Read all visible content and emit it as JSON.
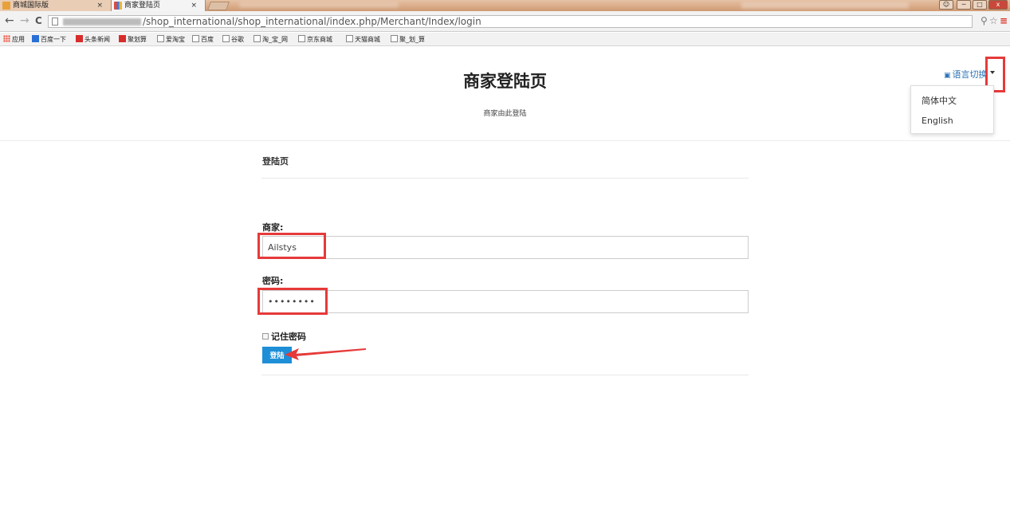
{
  "browser": {
    "tabs": [
      {
        "label": "商城国际版",
        "active": false,
        "close": "×"
      },
      {
        "label": "商家登陆页",
        "active": true,
        "close": "×"
      }
    ],
    "window_controls": {
      "minimize": "─",
      "maximize": "□",
      "close": "x"
    },
    "nav": {
      "back": "←",
      "forward": "→",
      "reload": "C"
    },
    "url_path": "/shop_international/shop_international/index.php/Merchant/Index/login",
    "bookmarks": [
      "应用",
      "百度一下",
      "头条新闻",
      "聚划算",
      "爱淘宝",
      "百度",
      "谷歌",
      "淘_宝_网",
      "京东商城",
      "天猫商城",
      "聚_划_算"
    ]
  },
  "header": {
    "title": "商家登陆页",
    "subtitle": "商家由此登陆",
    "lang_toggle": "语言切换",
    "lang_options": [
      "简体中文",
      "English"
    ]
  },
  "form": {
    "panel_title": "登陆页",
    "merchant_label": "商家:",
    "merchant_value": "Ailstys",
    "password_label": "密码:",
    "password_value": "••••••••",
    "remember_label": "记住密码",
    "remember_checked": false,
    "submit_label": "登陆"
  },
  "colors": {
    "annotation_red": "#e63a3a",
    "button_blue": "#1e8fd6",
    "link_blue": "#2a72b5"
  }
}
